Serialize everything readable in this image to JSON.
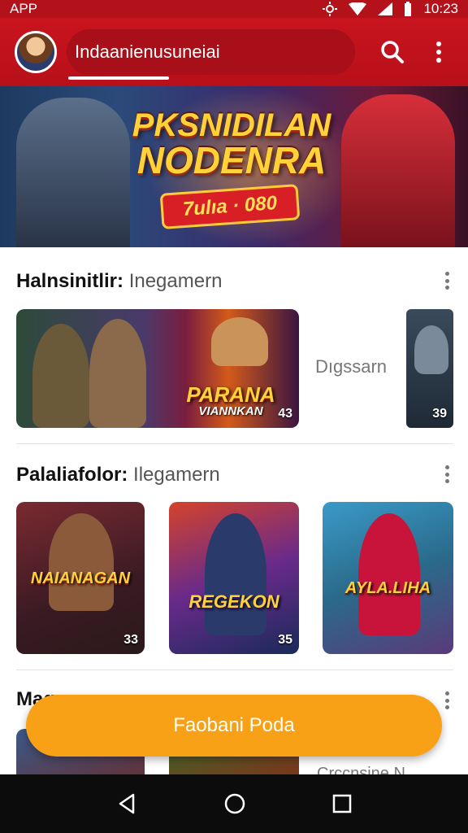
{
  "status_bar": {
    "app_label": "APP",
    "time": "10:23"
  },
  "app_bar": {
    "search_text": "Indaanienusuneiai"
  },
  "hero": {
    "title_line1": "PKSNIDILAN",
    "title_line2": "NODENRA",
    "badge": "7ulıa · 080"
  },
  "sections": [
    {
      "title_bold": "Halnsinitlir:",
      "title_light": "Inegamern",
      "side_label": "Dıgssarn",
      "cards": [
        {
          "art_title": "PARANA",
          "art_subtitle": "VIANNKAN",
          "count": "43"
        },
        {
          "count": "39"
        }
      ]
    },
    {
      "title_bold": "Palaliafolor:",
      "title_light": "Ilegamern",
      "cards": [
        {
          "art_title": "NAIANAGAN",
          "count": "33"
        },
        {
          "art_title": "REGEKON",
          "count": "35"
        },
        {
          "art_title": "AYLA.LIHA"
        }
      ]
    },
    {
      "title_bold": "Maq...",
      "side_label": "Crccnsine N"
    }
  ],
  "fab": {
    "label": "Faobani Poda"
  },
  "colors": {
    "brand": "#c8141e",
    "accent": "#f8a116"
  }
}
